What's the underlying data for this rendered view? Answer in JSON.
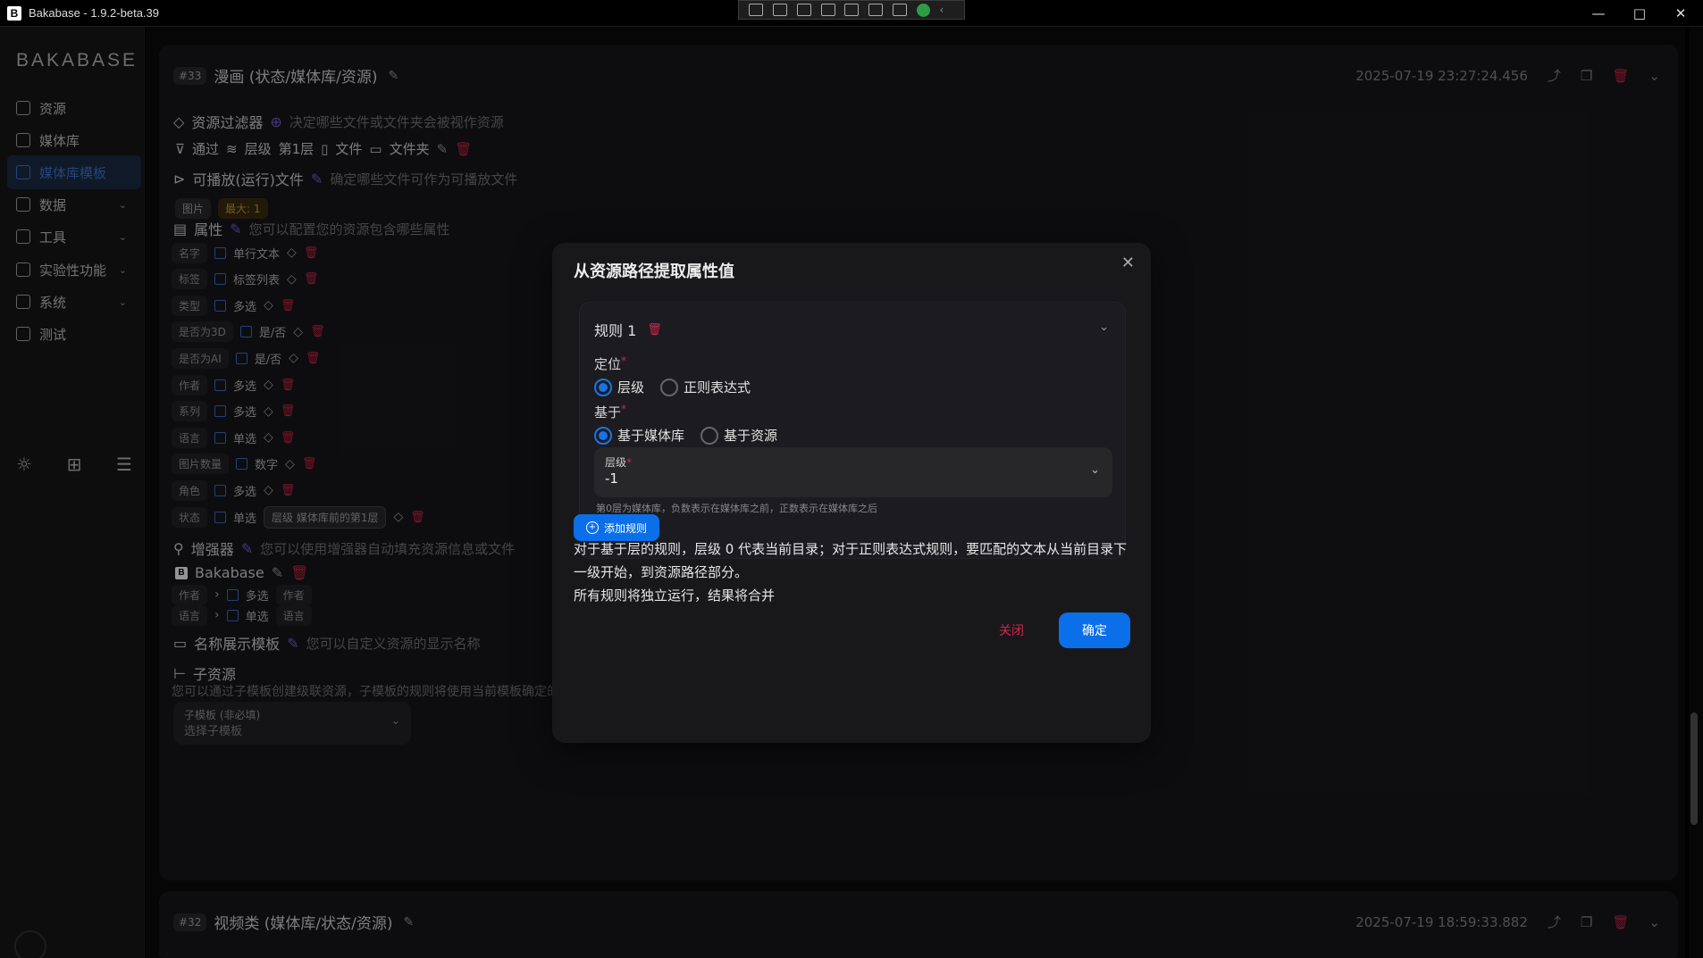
{
  "window": {
    "title": "Bakabase - 1.9.2-beta.39",
    "app_logo": "B"
  },
  "window_controls": {
    "minimize": "—",
    "maximize": "□",
    "close": "✕"
  },
  "sidebar": {
    "brand": "BAKABASE",
    "items": [
      {
        "label": "资源",
        "icon": "image-icon",
        "expandable": false
      },
      {
        "label": "媒体库",
        "icon": "grid-icon",
        "expandable": false
      },
      {
        "label": "媒体库模板",
        "icon": "template-icon",
        "expandable": false,
        "active": true
      },
      {
        "label": "数据",
        "icon": "database-icon",
        "expandable": true
      },
      {
        "label": "工具",
        "icon": "wrench-icon",
        "expandable": true
      },
      {
        "label": "实验性功能",
        "icon": "flask-icon",
        "expandable": true
      },
      {
        "label": "系统",
        "icon": "gear-icon",
        "expandable": true
      },
      {
        "label": "测试",
        "icon": "bug-icon",
        "expandable": false
      }
    ],
    "chevron": "⌄",
    "bottom_icons": [
      "sun-icon",
      "image-plus-icon",
      "list-indent-icon"
    ],
    "bottom_glyphs": [
      "☼",
      "⊞",
      "☰"
    ]
  },
  "template33": {
    "number": "#33",
    "title": "漫画 (状态/媒体库/资源)",
    "timestamp": "2025-07-19 23:27:24.456",
    "resource_filter": {
      "label": "资源过滤器",
      "hint": "决定哪些文件或文件夹会被视作资源",
      "rule": [
        "通过",
        "层级",
        "第1层",
        "文件",
        "文件夹"
      ]
    },
    "playable": {
      "label": "可播放(运行)文件",
      "hint": "确定哪些文件可作为可播放文件",
      "chips": [
        "图片",
        "最大: 1"
      ]
    },
    "attributes": {
      "label": "属性",
      "hint": "您可以配置您的资源包含哪些属性",
      "rows": [
        {
          "name": "名字",
          "type": "单行文本"
        },
        {
          "name": "标签",
          "type": "标签列表"
        },
        {
          "name": "类型",
          "type": "多选"
        },
        {
          "name": "是否为3D",
          "type": "是/否"
        },
        {
          "name": "是否为AI",
          "type": "是/否"
        },
        {
          "name": "作者",
          "type": "多选"
        },
        {
          "name": "系列",
          "type": "多选"
        },
        {
          "name": "语言",
          "type": "单选"
        },
        {
          "name": "图片数量",
          "type": "数字"
        },
        {
          "name": "角色",
          "type": "多选"
        },
        {
          "name": "状态",
          "type": "单选",
          "extra": "层级 媒体库前的第1层"
        }
      ]
    },
    "enhancer": {
      "label": "增强器",
      "hint": "您可以使用增强器自动填充资源信息或文件",
      "source": "Bakabase",
      "rows": [
        {
          "name": "作者",
          "type": "多选",
          "target": "作者"
        },
        {
          "name": "语言",
          "type": "单选",
          "target": "语言"
        }
      ]
    },
    "display_name": {
      "label": "名称展示模板",
      "hint": "您可以自定义资源的显示名称"
    },
    "child": {
      "label": "子资源",
      "hint": "您可以通过子模板创建级联资源，子模板的规则将使用当前模板确定的资源路径作为根目录。",
      "select_label": "子模板 (非必填)",
      "select_placeholder": "选择子模板"
    }
  },
  "template32": {
    "number": "#32",
    "title": "视频类 (媒体库/状态/资源)",
    "timestamp": "2025-07-19 18:59:33.882"
  },
  "modal": {
    "title": "从资源路径提取属性值",
    "close_icon": "✕",
    "rule_title": "规则 1",
    "locate_label": "定位",
    "locate_options": [
      "层级",
      "正则表达式"
    ],
    "locate_selected": "层级",
    "base_label": "基于",
    "base_options": [
      "基于媒体库",
      "基于资源"
    ],
    "base_selected": "基于媒体库",
    "level_label": "层级",
    "level_value": "-1",
    "helper": "第0层为媒体库，负数表示在媒体库之前，正数表示在媒体库之后",
    "add_rule": "添加规则",
    "desc_1": "对于基于层的规则，层级 0 代表当前目录；对于正则表达式规则，要匹配的文本从当前目录下一级开始，到资源路径部分。",
    "desc_2": "所有规则将独立运行，结果将合并",
    "cancel": "关闭",
    "confirm": "确定"
  },
  "colors": {
    "accent": "#0a6fe8",
    "danger": "#d5234b",
    "panel": "#18181b",
    "background": "#0b0b0c"
  }
}
